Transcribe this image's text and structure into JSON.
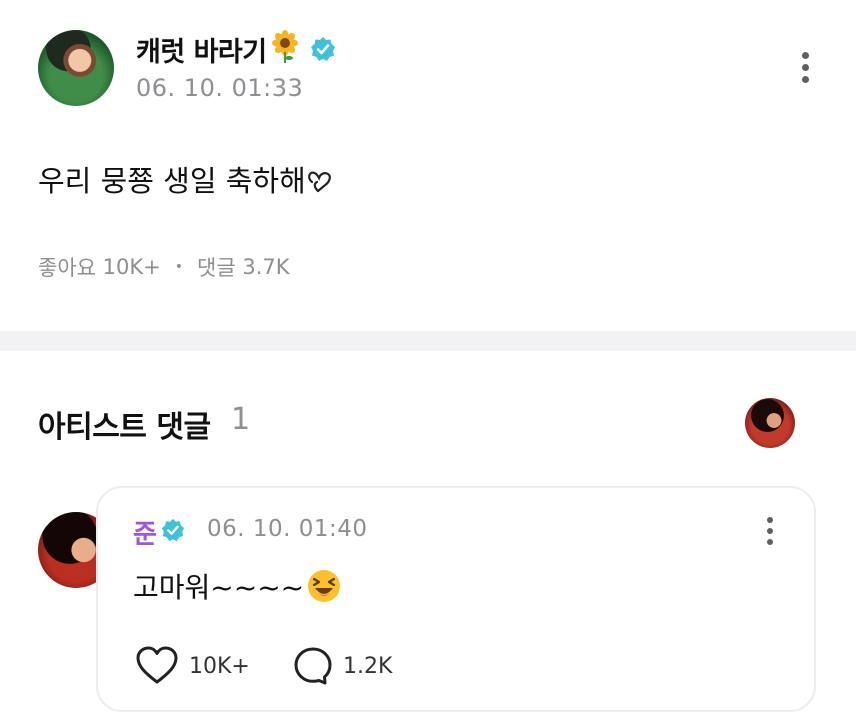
{
  "post": {
    "author": "캐럿 바라기",
    "timestamp": "06. 10. 01:33",
    "body": "우리 뭉쭁 생일 축하해",
    "likes_label": "좋아요",
    "likes_count": "10K+",
    "comments_label": "댓글",
    "comments_count": "3.7K"
  },
  "artist_section": {
    "title": "아티스트 댓글",
    "count": "1"
  },
  "comment": {
    "author": "준",
    "timestamp": "06. 10. 01:40",
    "body": "고마워~~~~",
    "like_count": "10K+",
    "reply_count": "1.2K"
  },
  "colors": {
    "verified": "#3fc1d9",
    "artist_name": "#9d57d8",
    "muted_text": "#8e8e93",
    "divider": "#f2f2f4"
  },
  "icons": [
    "verified-badge-icon",
    "sunflower-icon",
    "more-options-icon",
    "heart-icon",
    "comment-bubble-icon",
    "laughing-face-icon",
    "heart-outline-emoji-icon"
  ]
}
